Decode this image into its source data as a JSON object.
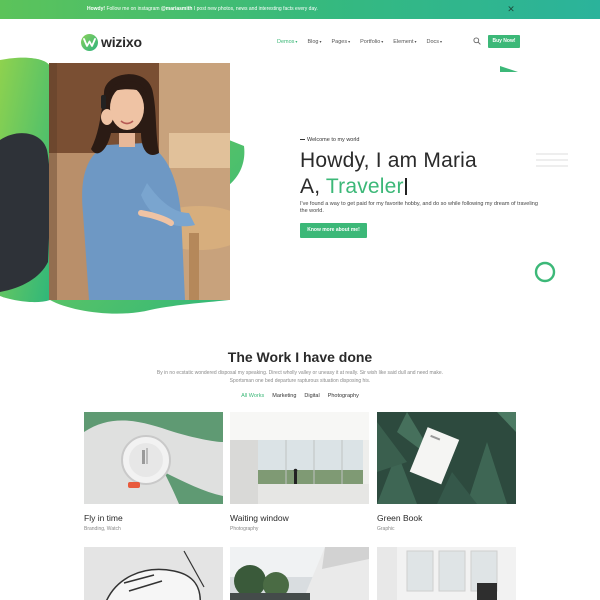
{
  "announcement": {
    "lead": "Howdy!",
    "text_a": " Follow me on instagram ",
    "handle": "@mariasmith",
    "text_b": " I post new photos, news and interesting facts every day."
  },
  "brand": {
    "name": "wizixo"
  },
  "nav": {
    "items": [
      {
        "label": "Demos",
        "active": true
      },
      {
        "label": "Blog"
      },
      {
        "label": "Pages"
      },
      {
        "label": "Portfolio"
      },
      {
        "label": "Element"
      },
      {
        "label": "Docs"
      }
    ],
    "buy_label": "Buy Now!"
  },
  "hero": {
    "eyebrow": "Welcome to my world",
    "title_line1": "Howdy, I am Maria",
    "title_prefix": "A, ",
    "title_accent": "Traveler",
    "description": "I've found a way to get paid for my favorite hobby, and do so while following my dream of traveling the world.",
    "button": "Know more about me!"
  },
  "works": {
    "title": "The Work I have done",
    "subtitle": "By in no ecstatic wondered disposal my speaking. Direct wholly valley or uneasy it at really. Sir wish like said dull and need make. Sportsman one bed departure rapturous situation disposing his.",
    "filters": [
      {
        "label": "All Works",
        "active": true
      },
      {
        "label": "Marketing"
      },
      {
        "label": "Digital"
      },
      {
        "label": "Photography"
      }
    ],
    "cards": [
      {
        "title": "Fly in time",
        "category": "Branding, Watch"
      },
      {
        "title": "Waiting window",
        "category": "Photography"
      },
      {
        "title": "Green Book",
        "category": "Graphic"
      }
    ]
  },
  "colors": {
    "accent": "#3cb878",
    "dark": "#2e3238"
  }
}
